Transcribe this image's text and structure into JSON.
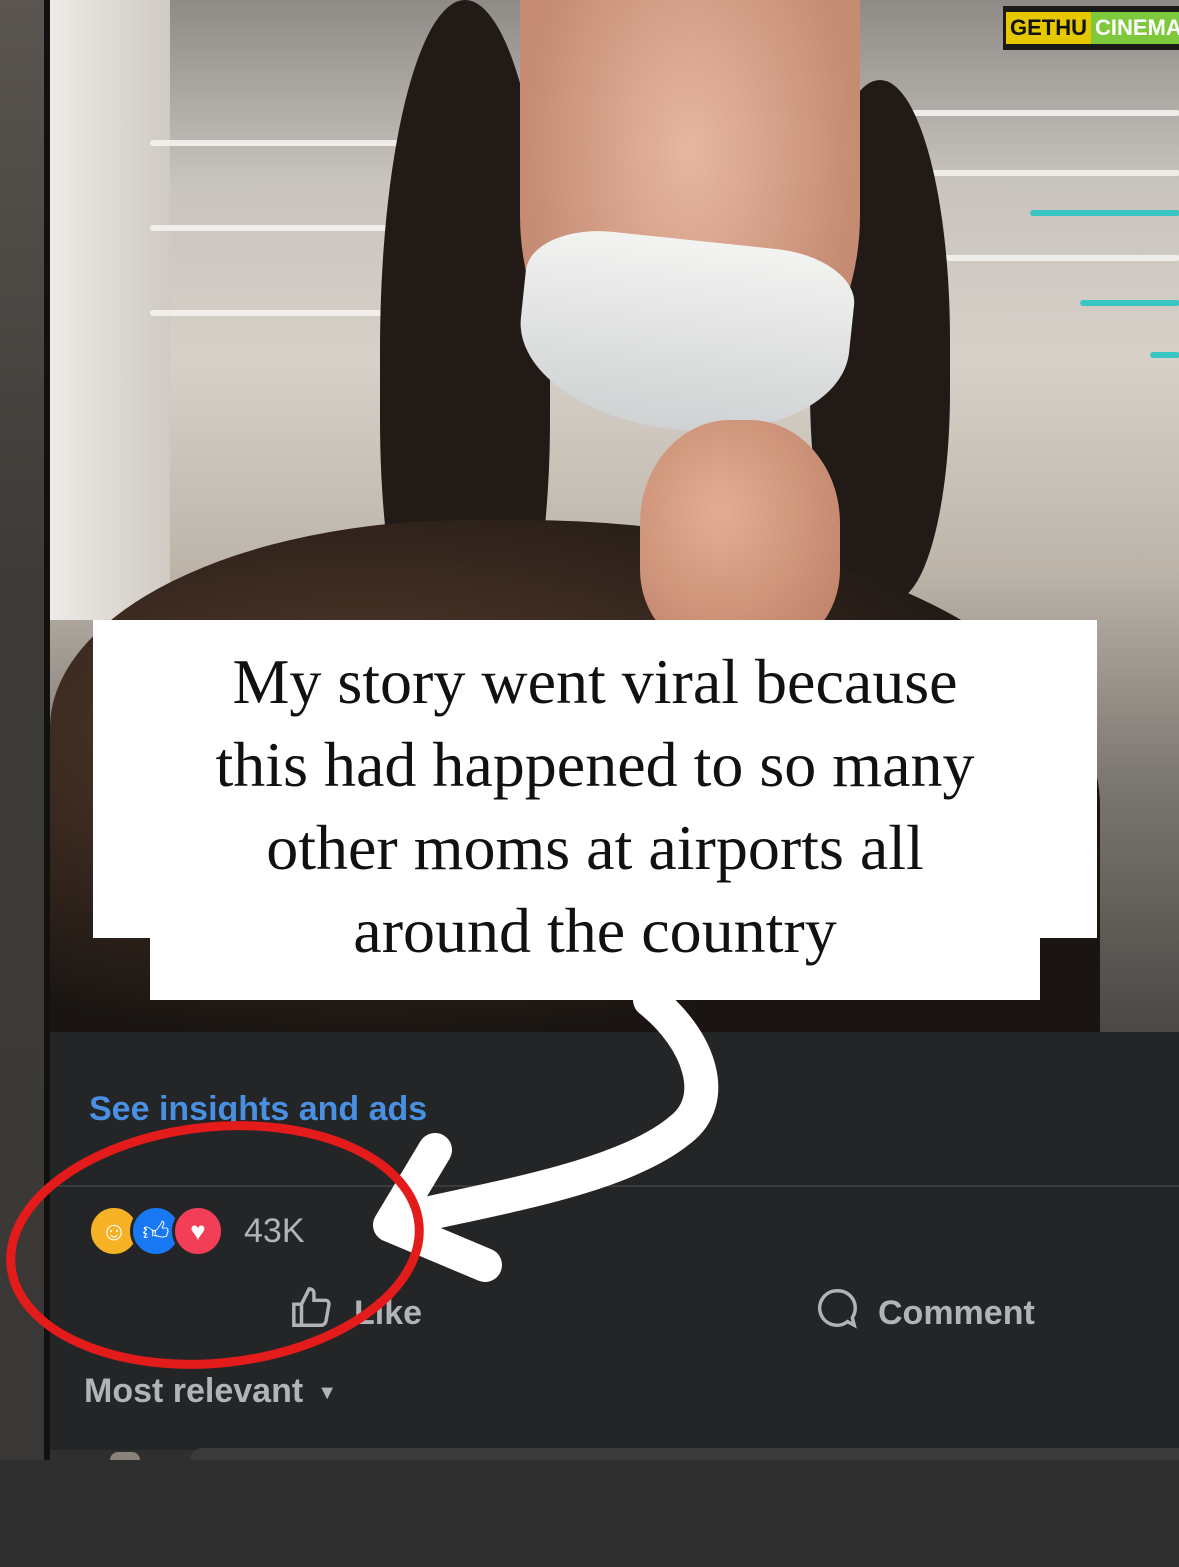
{
  "watermark": {
    "part1": "GETHU",
    "part2": "CINEMA"
  },
  "caption": {
    "lines": [
      "My story went viral because",
      "this had happened to so many",
      "other moms at airports all",
      "around the country"
    ]
  },
  "post": {
    "insights_link": "See insights and ads",
    "reactions": {
      "icons": [
        "care-reaction",
        "like-reaction",
        "love-reaction"
      ],
      "count": "43K"
    },
    "actions": {
      "like": "Like",
      "comment": "Comment"
    },
    "sort": {
      "label": "Most relevant"
    }
  },
  "colors": {
    "panel_bg": "#242526",
    "link": "#4a90e2",
    "muted_text": "#b0b3b8",
    "annotation_red": "#e31b1b",
    "like_blue": "#1877f2",
    "love_red": "#f33e58",
    "care_yellow": "#f7b125"
  }
}
